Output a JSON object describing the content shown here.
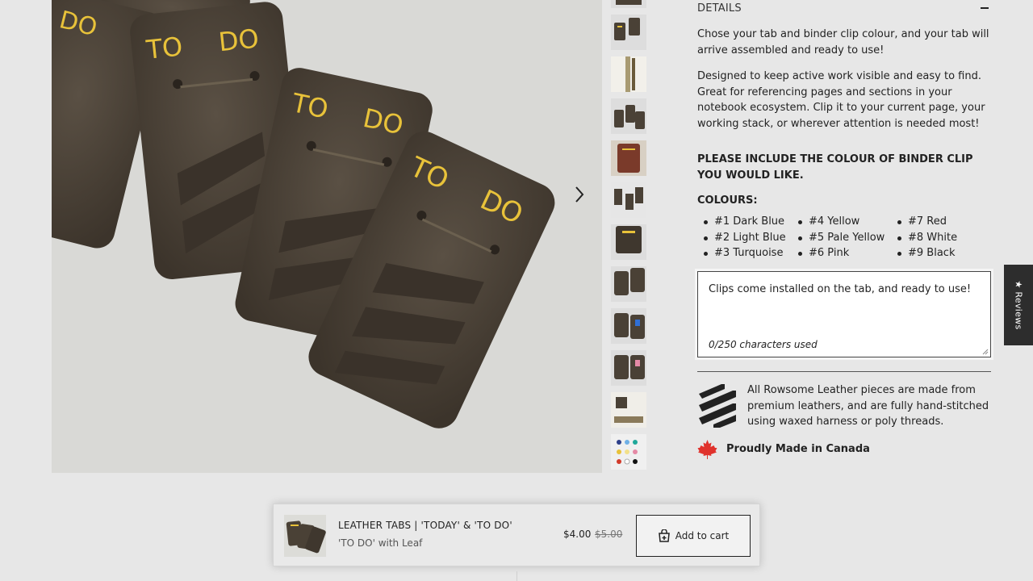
{
  "gallery": {
    "main_image_icon": "leather-tabs-photo",
    "tab_text_to": "TO",
    "tab_text_do": "DO",
    "next_icon": "chevron-right-icon",
    "thumbnail_count": 12
  },
  "details": {
    "heading": "DETAILS",
    "toggle_icon": "minus-icon",
    "para1": "Chose your tab and binder clip colour, and your tab will arrive assembled and ready to use!",
    "para2": "Designed to keep active work visible and easy to find. Great for referencing pages and sections in your notebook ecosystem. Clip it to your current page, your working stack, or wherever attention is needed most!",
    "notice": "PLEASE INCLUDE THE COLOUR OF BINDER CLIP YOU WOULD LIKE.",
    "colours_heading": "COLOURS:",
    "colours_col1": [
      "#1 Dark Blue",
      "#2 Light Blue",
      "#3 Turquoise"
    ],
    "colours_col2": [
      "#4 Yellow",
      "#5 Pale Yellow",
      "#6 Pink"
    ],
    "colours_col3": [
      "#7 Red",
      "#8 White",
      "#9 Black"
    ]
  },
  "note": {
    "placeholder": "Clips come installed on the tab, and ready to use!",
    "counter": "0/250 characters used"
  },
  "leather_info": {
    "text": "All Rowsome Leather pieces are made from premium leathers, and are fully hand-stitched using waxed harness or poly threads.",
    "made_in": "Proudly Made in Canada"
  },
  "reviews_tab": {
    "label": "★ Reviews"
  },
  "cart_bar": {
    "title": "LEATHER TABS | 'TODAY' & 'TO DO'",
    "variant": "'TO DO' with Leaf",
    "price": "$4.00",
    "compare_price": "$5.00",
    "add_label": "Add to cart"
  },
  "colors": {
    "background": "#e7e7e7",
    "leather": "#4a4136",
    "gold_foil": "#e8c23a",
    "canada_red": "#e0322c",
    "reviews_bg": "#2d2d2d"
  }
}
